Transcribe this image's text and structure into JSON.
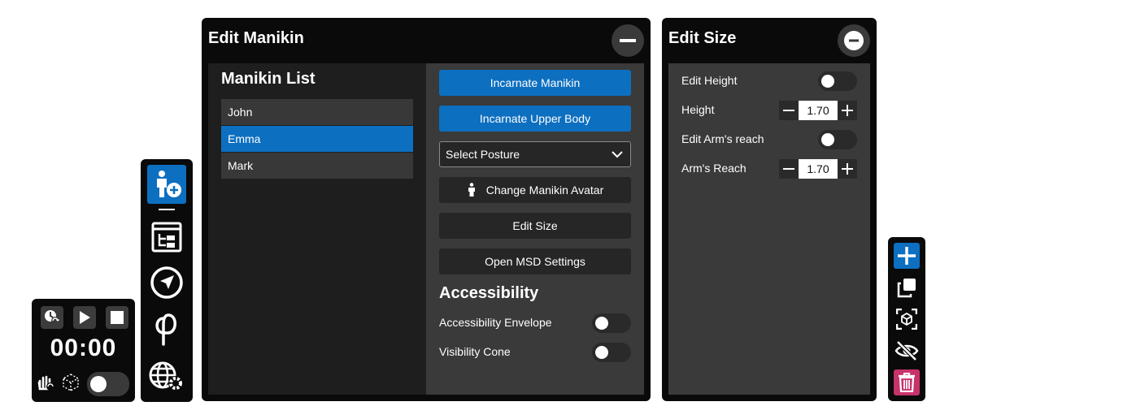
{
  "timer": {
    "time": "00:00",
    "toggle_on": false
  },
  "toolbar": {
    "items": [
      {
        "icon": "add-manikin-icon",
        "active": true
      },
      {
        "icon": "structure-tree-icon",
        "active": false
      },
      {
        "icon": "navigation-icon",
        "active": false
      },
      {
        "icon": "phi-icon",
        "active": false
      },
      {
        "icon": "globe-settings-icon",
        "active": false
      }
    ]
  },
  "manikin_window": {
    "title": "Edit Manikin",
    "list_title": "Manikin List",
    "manikins": [
      "John",
      "Emma",
      "Mark"
    ],
    "selected": "Emma",
    "incarnate_label": "Incarnate Manikin",
    "incarnate_upper_label": "Incarnate Upper Body",
    "posture_placeholder": "Select Posture",
    "change_avatar_label": "Change Manikin Avatar",
    "edit_size_label": "Edit Size",
    "msd_label": "Open MSD Settings",
    "accessibility_title": "Accessibility",
    "accessibility_envelope_label": "Accessibility Envelope",
    "visibility_cone_label": "Visibility Cone"
  },
  "size_window": {
    "title": "Edit Size",
    "edit_height_label": "Edit Height",
    "height_label": "Height",
    "height_value": "1.70",
    "edit_arm_label": "Edit Arm's reach",
    "arm_reach_label": "Arm's Reach",
    "arm_reach_value": "1.70"
  },
  "right_toolbar": {
    "items": [
      "add-icon",
      "duplicate-icon",
      "focus-icon",
      "hide-icon",
      "delete-icon"
    ]
  },
  "colors": {
    "accent": "#0d6fc0",
    "danger": "#c8326c",
    "panel": "#0a0a0a"
  }
}
